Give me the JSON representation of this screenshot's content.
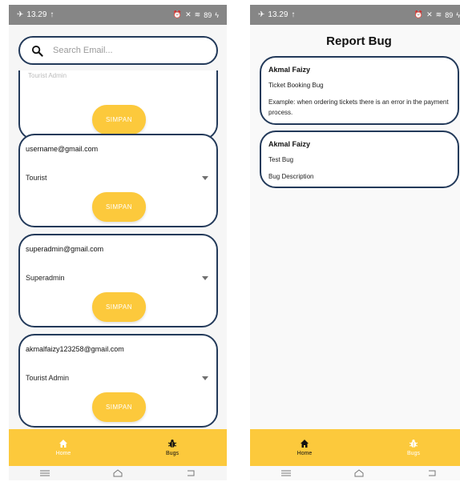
{
  "status_bar": {
    "time": "13.29",
    "battery": "89"
  },
  "users_screen": {
    "search_placeholder": "Search Email...",
    "partial_card": {
      "role_cut": "Tourist Admin",
      "button": "SIMPAN"
    },
    "users": [
      {
        "email": "username@gmail.com",
        "role": "Tourist",
        "button": "SIMPAN"
      },
      {
        "email": "superadmin@gmail.com",
        "role": "Superadmin",
        "button": "SIMPAN"
      },
      {
        "email": "akmalfaizy123258@gmail.com",
        "role": "Tourist Admin",
        "button": "SIMPAN"
      }
    ]
  },
  "bugs_screen": {
    "title": "Report Bug",
    "reports": [
      {
        "author": "Akmal Faizy",
        "title": "Ticket Booking Bug",
        "description": "Example: when ordering tickets there is an error in the payment process."
      },
      {
        "author": "Akmal Faizy",
        "title": "Test Bug",
        "description": "Bug Description"
      }
    ]
  },
  "bottom_nav": {
    "home": "Home",
    "bugs": "Bugs"
  },
  "colors": {
    "accent": "#fcc93c",
    "card_border": "#233a5a",
    "status_bar": "#868686"
  }
}
